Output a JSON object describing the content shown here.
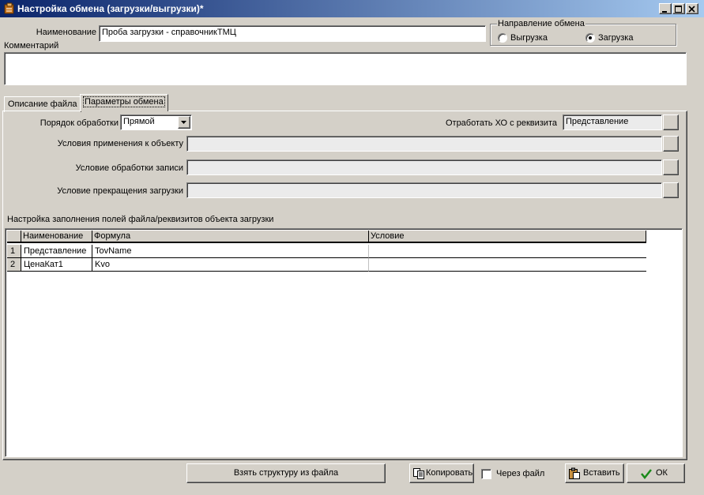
{
  "window": {
    "title": "Настройка обмена (загрузки/выгрузки)*"
  },
  "form": {
    "name_label": "Наименование",
    "name_value": "Проба загрузки - справочникТМЦ",
    "comment_label": "Комментарий",
    "comment_value": ""
  },
  "direction": {
    "group_label": "Направление обмена",
    "options": [
      {
        "label": "Выгрузка",
        "selected": false
      },
      {
        "label": "Загрузка",
        "selected": true
      }
    ]
  },
  "tabs": [
    {
      "label": "Описание файла",
      "active": false
    },
    {
      "label": "Параметры обмена",
      "active": true
    }
  ],
  "params": {
    "order_label": "Порядок обработки",
    "order_value": "Прямой",
    "process_label": "Отработать ХО с реквизита",
    "process_value": "Представление",
    "apply_label": "Условия применения к объекту",
    "apply_value": "",
    "record_label": "Условие обработки записи",
    "record_value": "",
    "stop_label": "Условие прекращения загрузки",
    "stop_value": ""
  },
  "table": {
    "title": "Настройка заполнения полей файла/реквизитов объекта загрузки",
    "columns": [
      "",
      "Наименование",
      "Формула",
      "Условие"
    ],
    "rows": [
      [
        "1",
        "Представление",
        "TovName",
        ""
      ],
      [
        "2",
        "ЦенаКат1",
        "Kvo",
        ""
      ]
    ]
  },
  "buttons": {
    "structure": "Взять структуру из файла",
    "copy": "Копировать",
    "via_file": "Через файл",
    "paste": "Вставить",
    "ok": "ОК"
  }
}
